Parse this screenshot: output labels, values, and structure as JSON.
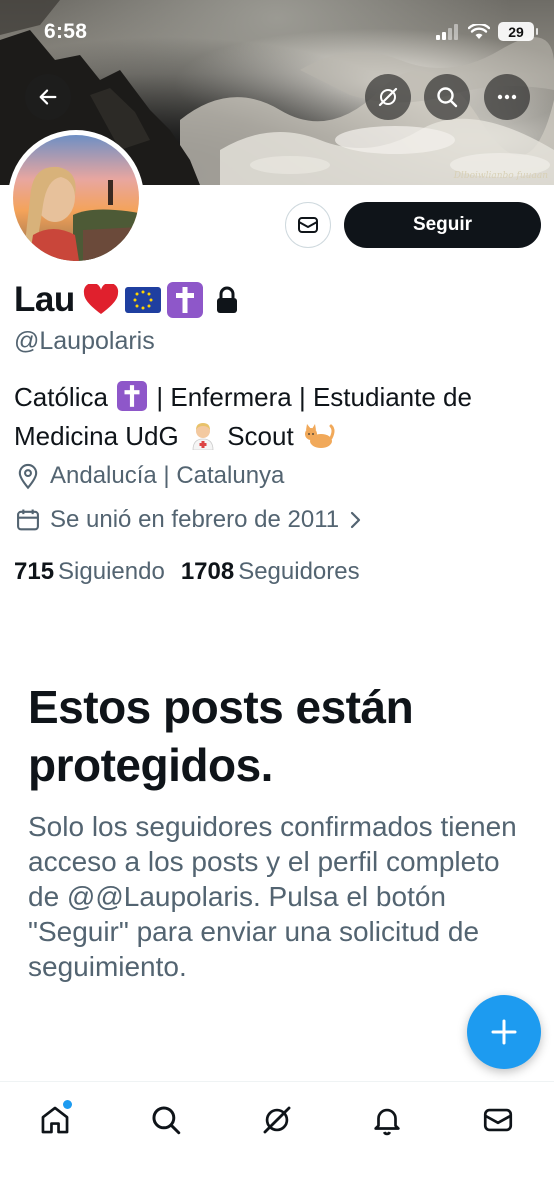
{
  "status_bar": {
    "time": "6:58",
    "battery": "29"
  },
  "banner": {
    "signature": "Dlboiwlianbo fuuaan"
  },
  "header_actions": {
    "back_icon": "arrow-left-icon",
    "grok_icon": "grok-icon",
    "search_icon": "search-icon",
    "more_icon": "more-horizontal-icon"
  },
  "profile": {
    "name": "Lau",
    "handle": "@Laupolaris",
    "bio_part1": "Católica",
    "bio_part2": "| Enfermera | Estudiante de Medicina UdG",
    "bio_part3": "Scout",
    "location": "Andalucía | Catalunya",
    "joined": "Se unió en febrero de 2011",
    "following_count": "715",
    "following_label": "Siguiendo",
    "followers_count": "1708",
    "followers_label": "Seguidores"
  },
  "actions": {
    "follow_label": "Seguir"
  },
  "protected": {
    "title": "Estos posts están protegidos.",
    "text": "Solo los seguidores confirmados tienen acceso a los posts y el perfil completo de @@Laupolaris. Pulsa el botón \"Seguir\" para enviar una solicitud de seguimiento."
  },
  "colors": {
    "accent": "#1d9bf0",
    "text_primary": "#0f1419",
    "text_secondary": "#536471",
    "follow_button": "#0f1419"
  },
  "bottom_nav": {
    "items": [
      "home-icon",
      "search-icon",
      "grok-icon",
      "notifications-icon",
      "messages-icon"
    ]
  }
}
